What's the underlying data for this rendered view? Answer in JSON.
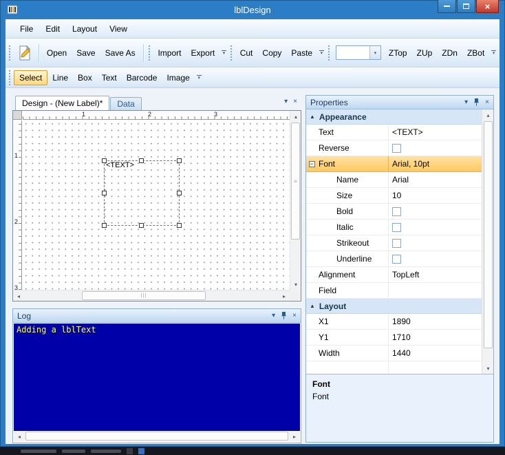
{
  "window": {
    "title": "lblDesign"
  },
  "icons": {
    "close": "×",
    "dropdown": "▾",
    "panel_close": "×",
    "s_up": "▴",
    "s_down": "▾",
    "s_left": "◂",
    "s_right": "▸",
    "grip_v": "≡",
    "grip_h": "|||",
    "collapse": "▲",
    "expander": "−"
  },
  "menu": {
    "items": [
      "File",
      "Edit",
      "Layout",
      "View"
    ]
  },
  "toolbar": {
    "file": [
      "Open",
      "Save",
      "Save As"
    ],
    "io": [
      "Import",
      "Export"
    ],
    "clipboard": [
      "Cut",
      "Copy",
      "Paste"
    ],
    "zorder": [
      "ZTop",
      "ZUp",
      "ZDn",
      "ZBot"
    ],
    "combo_value": "",
    "tools": [
      "Select",
      "Line",
      "Box",
      "Text",
      "Barcode",
      "Image"
    ]
  },
  "design": {
    "tab_design": "Design - (New Label)*",
    "tab_data": "Data",
    "ruler_h": [
      "1",
      "2",
      "3"
    ],
    "ruler_v": [
      "1",
      "2",
      "3"
    ],
    "element_text": "<TEXT>"
  },
  "log": {
    "title": "Log",
    "line1": "Adding a lblText"
  },
  "properties": {
    "title": "Properties",
    "cat_appearance": "Appearance",
    "cat_layout": "Layout",
    "rows": {
      "text": {
        "label": "Text",
        "value": "<TEXT>"
      },
      "reverse": {
        "label": "Reverse"
      },
      "font": {
        "label": "Font",
        "value": "Arial, 10pt"
      },
      "name": {
        "label": "Name",
        "value": "Arial"
      },
      "size": {
        "label": "Size",
        "value": "10"
      },
      "bold": {
        "label": "Bold"
      },
      "italic": {
        "label": "Italic"
      },
      "strikeout": {
        "label": "Strikeout"
      },
      "underline": {
        "label": "Underline"
      },
      "alignment": {
        "label": "Alignment",
        "value": "TopLeft"
      },
      "field": {
        "label": "Field",
        "value": ""
      },
      "x1": {
        "label": "X1",
        "value": "1890"
      },
      "y1": {
        "label": "Y1",
        "value": "1710"
      },
      "width": {
        "label": "Width",
        "value": "1440"
      }
    },
    "desc_title": "Font",
    "desc_text": "Font"
  }
}
